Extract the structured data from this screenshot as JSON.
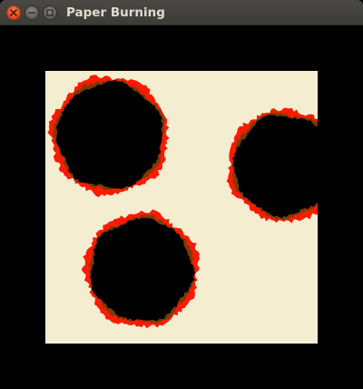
{
  "window": {
    "title": "Paper Burning",
    "buttons": {
      "close": "close-icon",
      "minimize": "minimize-icon",
      "maximize": "maximize-icon"
    }
  },
  "scene": {
    "background_color": "#000000",
    "paper_color": "#f5edd0",
    "burn_edge_color": "#ff1a00",
    "char_color": "#7a3b00",
    "hole_color": "#000000"
  }
}
